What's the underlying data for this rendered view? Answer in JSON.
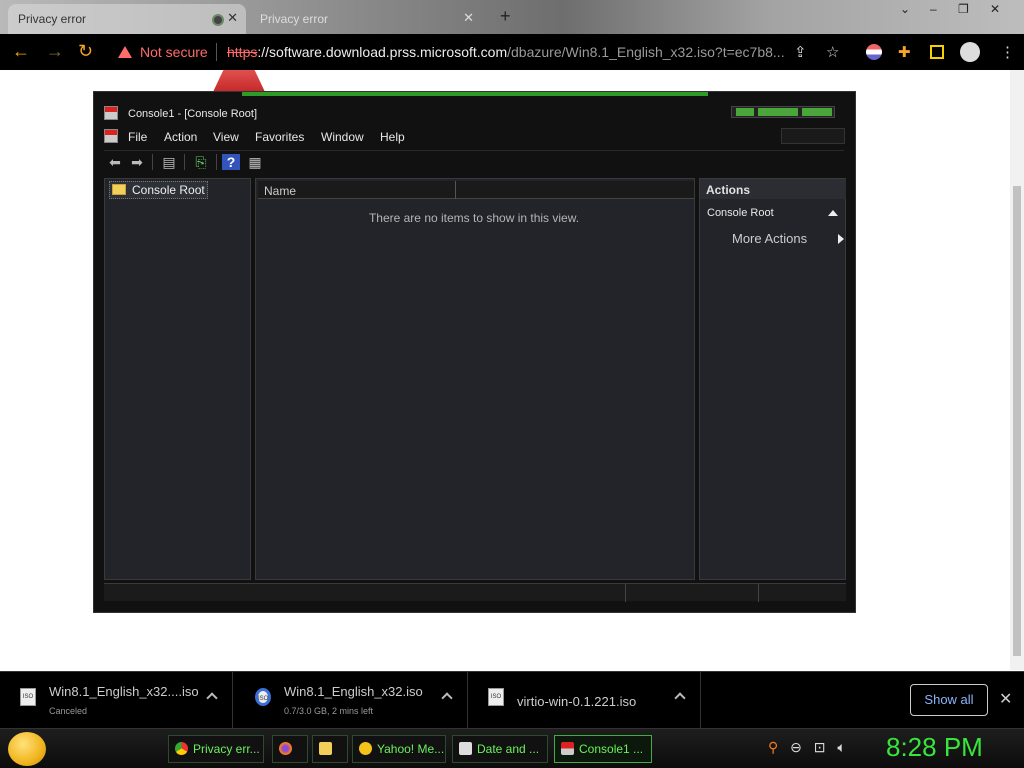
{
  "browser": {
    "tabs": [
      {
        "title": "Privacy error",
        "active": true
      },
      {
        "title": "Privacy error",
        "active": false
      }
    ],
    "new_tab": "+",
    "window_controls": [
      "–",
      "❐",
      "✕"
    ],
    "security_label": "Not secure",
    "url_scheme": "https",
    "url_host": "://software.download.prss.microsoft.com",
    "url_path": "/dbazure/Win8.1_English_x32.iso?t=ec7b8..."
  },
  "mmc": {
    "title": "Console1 - [Console Root]",
    "menu": [
      "File",
      "Action",
      "View",
      "Favorites",
      "Window",
      "Help"
    ],
    "tree": {
      "root": "Console Root"
    },
    "list": {
      "column_name": "Name",
      "empty_message": "There are no items to show in this view."
    },
    "actions": {
      "header": "Actions",
      "section": "Console Root",
      "more": "More Actions"
    }
  },
  "downloads": [
    {
      "name": "Win8.1_English_x32....iso",
      "status": "Canceled"
    },
    {
      "name": "Win8.1_English_x32.iso",
      "status": "0.7/3.0 GB, 2 mins left"
    },
    {
      "name": "virtio-win-0.1.221.iso",
      "status": ""
    }
  ],
  "downloads_show_all": "Show all",
  "taskbar": {
    "tasks": [
      {
        "label": "Privacy err...",
        "icon": "chrome-icon"
      },
      {
        "label": "",
        "icon": "firefox-icon"
      },
      {
        "label": "",
        "icon": "folder-icon"
      },
      {
        "label": "Yahoo! Me...",
        "icon": "yahoo-messenger-icon"
      },
      {
        "label": "Date and ...",
        "icon": "date-time-icon"
      },
      {
        "label": "Console1 ...",
        "icon": "mmc-icon"
      }
    ],
    "clock": "8:28 PM"
  },
  "colors": {
    "accent_green": "#38e63b",
    "warning_red": "#ff6b6b",
    "link_blue": "#8ab4f8"
  }
}
